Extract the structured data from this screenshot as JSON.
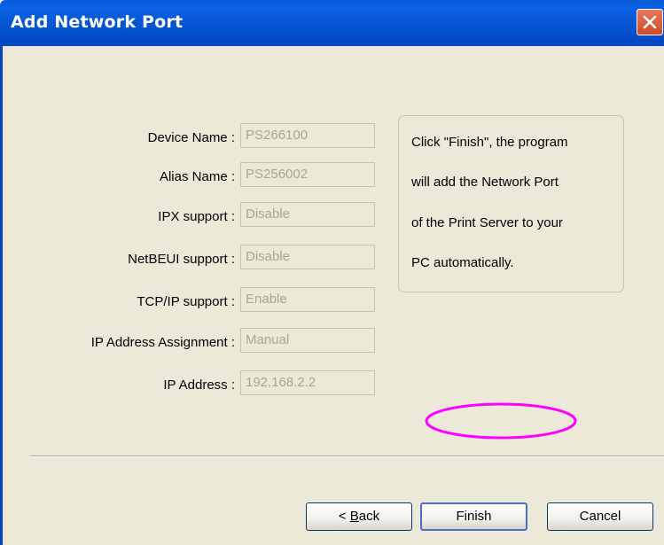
{
  "window": {
    "title": "Add Network Port"
  },
  "fields": [
    {
      "label": "Device Name :",
      "value": "PS266100"
    },
    {
      "label": "Alias Name :",
      "value": "PS256002"
    },
    {
      "label": "IPX support :",
      "value": "Disable"
    },
    {
      "label": "NetBEUI support :",
      "value": "Disable"
    },
    {
      "label": "TCP/IP support :",
      "value": "Enable"
    },
    {
      "label": "IP Address Assignment :",
      "value": "Manual"
    },
    {
      "label": "IP Address :",
      "value": "192.168.2.2"
    }
  ],
  "info": {
    "lines": [
      "Click \"Finish\", the program",
      "will add the Network Port",
      "of the Print Server to your",
      "PC automatically."
    ]
  },
  "buttons": {
    "back_prefix": "< ",
    "back_mnemonic": "B",
    "back_rest": "ack",
    "finish": "Finish",
    "cancel": "Cancel"
  },
  "colors": {
    "titlebar": "#0554d1",
    "client_bg": "#ece9d8",
    "annotation": "#ff00ff",
    "disabled_text": "#a7a596"
  },
  "icons": {
    "close": "close-icon"
  }
}
